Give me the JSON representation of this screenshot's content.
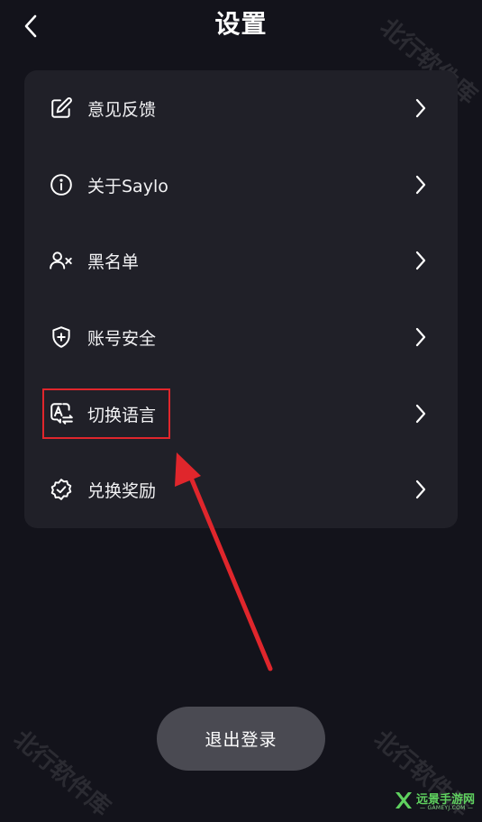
{
  "header": {
    "title": "设置"
  },
  "menu": {
    "items": [
      {
        "label": "意见反馈",
        "icon": "edit-icon"
      },
      {
        "label": "关于Saylo",
        "icon": "info-icon"
      },
      {
        "label": "黑名单",
        "icon": "user-block-icon"
      },
      {
        "label": "账号安全",
        "icon": "shield-plus-icon"
      },
      {
        "label": "切换语言",
        "icon": "language-icon"
      },
      {
        "label": "兑换奖励",
        "icon": "badge-check-icon"
      }
    ]
  },
  "logout": {
    "label": "退出登录"
  },
  "watermark": {
    "text": "北行软件库"
  },
  "corner_logo": {
    "name": "远景手游网",
    "url": "— GAMEYJ.COM —"
  },
  "colors": {
    "background": "#13131b",
    "card": "#202028",
    "button": "#4a4a52",
    "annotation": "#e0262c",
    "logo_green": "#5fd15f"
  }
}
